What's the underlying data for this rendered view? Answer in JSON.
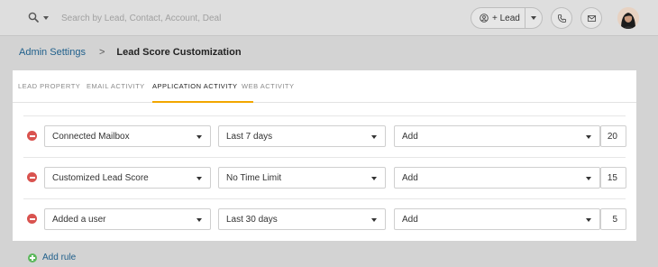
{
  "header": {
    "search": {
      "placeholder": "Search by Lead, Contact, Account, Deal"
    },
    "lead_button_label": "+ Lead",
    "icons": {
      "search": "search-icon",
      "add_lead": "user-circle-icon",
      "phone": "phone-icon",
      "mail": "mail-icon"
    }
  },
  "breadcrumb": {
    "parent": "Admin Settings",
    "separator": ">",
    "current": "Lead Score Customization"
  },
  "tabs": [
    {
      "label": "LEAD  PROPERTY",
      "active": false
    },
    {
      "label": "EMAIL  ACTIVITY",
      "active": false
    },
    {
      "label": "APPLICATION  ACTIVITY",
      "active": true
    },
    {
      "label": "WEB  ACTIVITY",
      "active": false
    }
  ],
  "rules": [
    {
      "activity": "Connected Mailbox",
      "period": "Last 7 days",
      "operation": "Add",
      "score": "20"
    },
    {
      "activity": "Customized Lead Score",
      "period": "No Time Limit",
      "operation": "Add",
      "score": "15"
    },
    {
      "activity": "Added a user",
      "period": "Last 30 days",
      "operation": "Add",
      "score": "5"
    }
  ],
  "add_rule_label": "Add rule",
  "colors": {
    "accent_tab": "#f2a700",
    "link": "#1f5f8b",
    "remove": "#d9534f",
    "add": "#5cb85c"
  }
}
